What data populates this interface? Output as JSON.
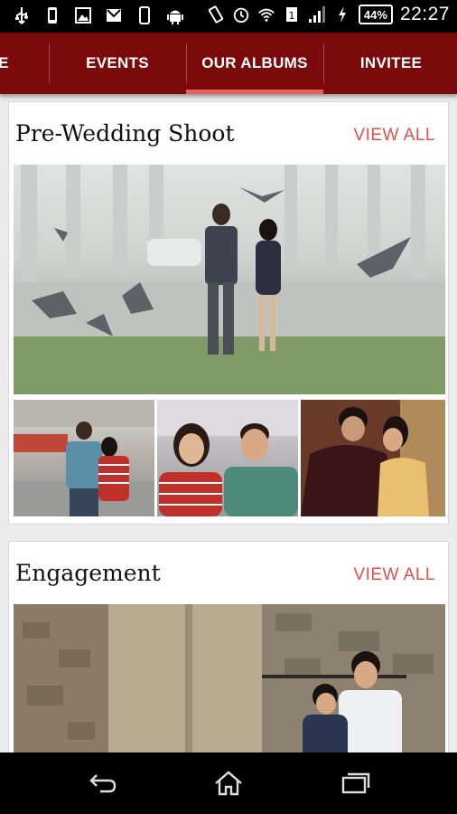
{
  "status_bar": {
    "battery": "44%",
    "time": "22:27",
    "left_icons": [
      "usb-icon",
      "phone-icon",
      "image-icon",
      "gmail-icon",
      "phone-outline-icon",
      "android-icon"
    ],
    "right_icons": [
      "vibrate-icon",
      "alarm-icon",
      "wifi-icon",
      "sim-icon",
      "signal-icon",
      "charging-icon"
    ]
  },
  "tabs": {
    "partial": "E",
    "events": "EVENTS",
    "albums": "OUR ALBUMS",
    "invitee": "INVITEE",
    "active": "OUR ALBUMS"
  },
  "albums": [
    {
      "title": "Pre-Wedding Shoot",
      "view_all": "VIEW ALL"
    },
    {
      "title": "Engagement",
      "view_all": "VIEW ALL"
    }
  ],
  "nav": [
    "back-icon",
    "home-icon",
    "recents-icon"
  ],
  "colors": {
    "tab_bar": "#7b0b0b",
    "tab_indicator": "#e85d5d",
    "view_all": "#e0504f",
    "background": "#ececec"
  }
}
